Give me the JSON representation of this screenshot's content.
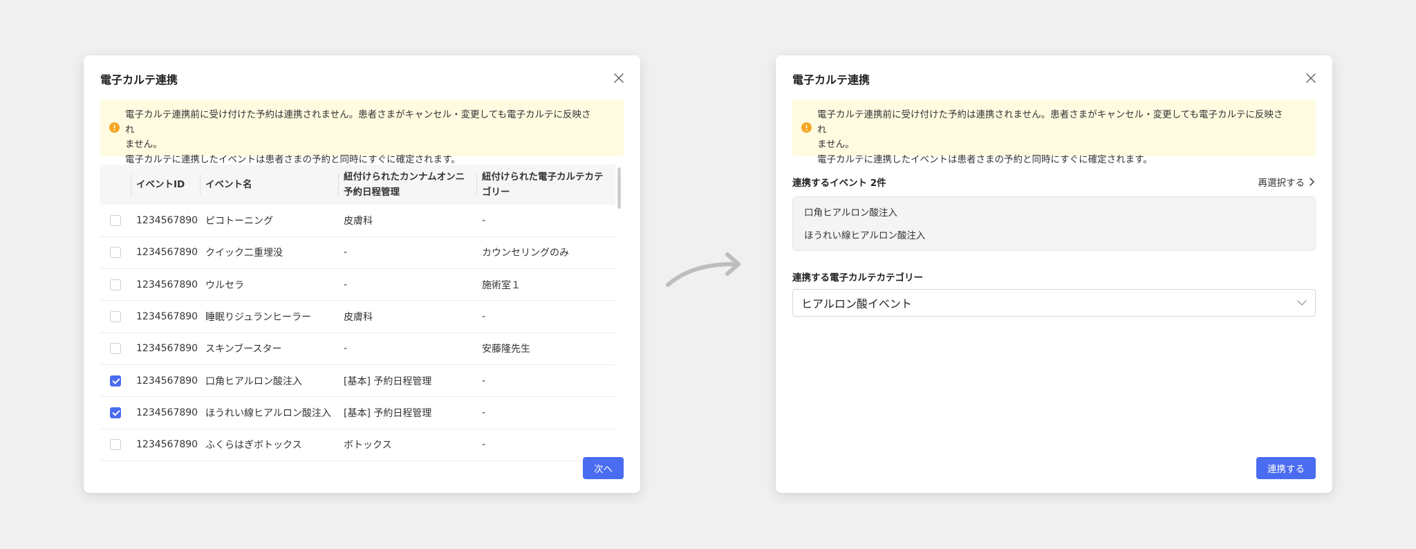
{
  "left_modal": {
    "title": "電子カルテ連携",
    "notice_line1": "電子カルテ連携前に受け付けた予約は連携されません。患者さまがキャンセル・変更しても電子カルテに反映され",
    "notice_line2": "ません。",
    "notice_line3": "電子カルテに連携したイベントは患者さまの予約と同時にすぐに確定されます。",
    "columns": {
      "event_id": "イベントID",
      "event_name": "イベント名",
      "linked_kannamu": "紐付けられたカンナムオンニ予約日程管理",
      "linked_category": "紐付けられた電子カルテカテゴリー"
    },
    "rows": [
      {
        "checked": false,
        "id": "1234567890",
        "name": "ピコトーニング",
        "schedule": "皮膚科",
        "category": "-"
      },
      {
        "checked": false,
        "id": "1234567890",
        "name": "クイック二重埋没",
        "schedule": "-",
        "category": "カウンセリングのみ"
      },
      {
        "checked": false,
        "id": "1234567890",
        "name": "ウルセラ",
        "schedule": "-",
        "category": "施術室１"
      },
      {
        "checked": false,
        "id": "1234567890",
        "name": "睡眠りジュランヒーラー",
        "schedule": "皮膚科",
        "category": "-"
      },
      {
        "checked": false,
        "id": "1234567890",
        "name": "スキンブースター",
        "schedule": "-",
        "category": "安藤隆先生"
      },
      {
        "checked": true,
        "id": "1234567890",
        "name": "口角ヒアルロン酸注入",
        "schedule": "[基本] 予約日程管理",
        "category": "-"
      },
      {
        "checked": true,
        "id": "1234567890",
        "name": "ほうれい線ヒアルロン酸注入",
        "schedule": "[基本] 予約日程管理",
        "category": "-"
      },
      {
        "checked": false,
        "id": "1234567890",
        "name": "ふくらはぎボトックス",
        "schedule": "ボトックス",
        "category": "-"
      }
    ],
    "next_label": "次へ"
  },
  "right_modal": {
    "title": "電子カルテ連携",
    "notice_line1": "電子カルテ連携前に受け付けた予約は連携されません。患者さまがキャンセル・変更しても電子カルテに反映され",
    "notice_line2": "ません。",
    "notice_line3": "電子カルテに連携したイベントは患者さまの予約と同時にすぐに確定されます。",
    "events_label": "連携するイベント 2件",
    "reselect_label": "再選択する",
    "selected_events": [
      "口角ヒアルロン酸注入",
      "ほうれい線ヒアルロン酸注入"
    ],
    "category_label": "連携する電子カルテカテゴリー",
    "category_value": "ヒアルロン酸イベント",
    "link_label": "連携する"
  },
  "colors": {
    "primary": "#4a6cf0",
    "notice_bg": "#fffbe0",
    "warning": "#f5a623"
  }
}
